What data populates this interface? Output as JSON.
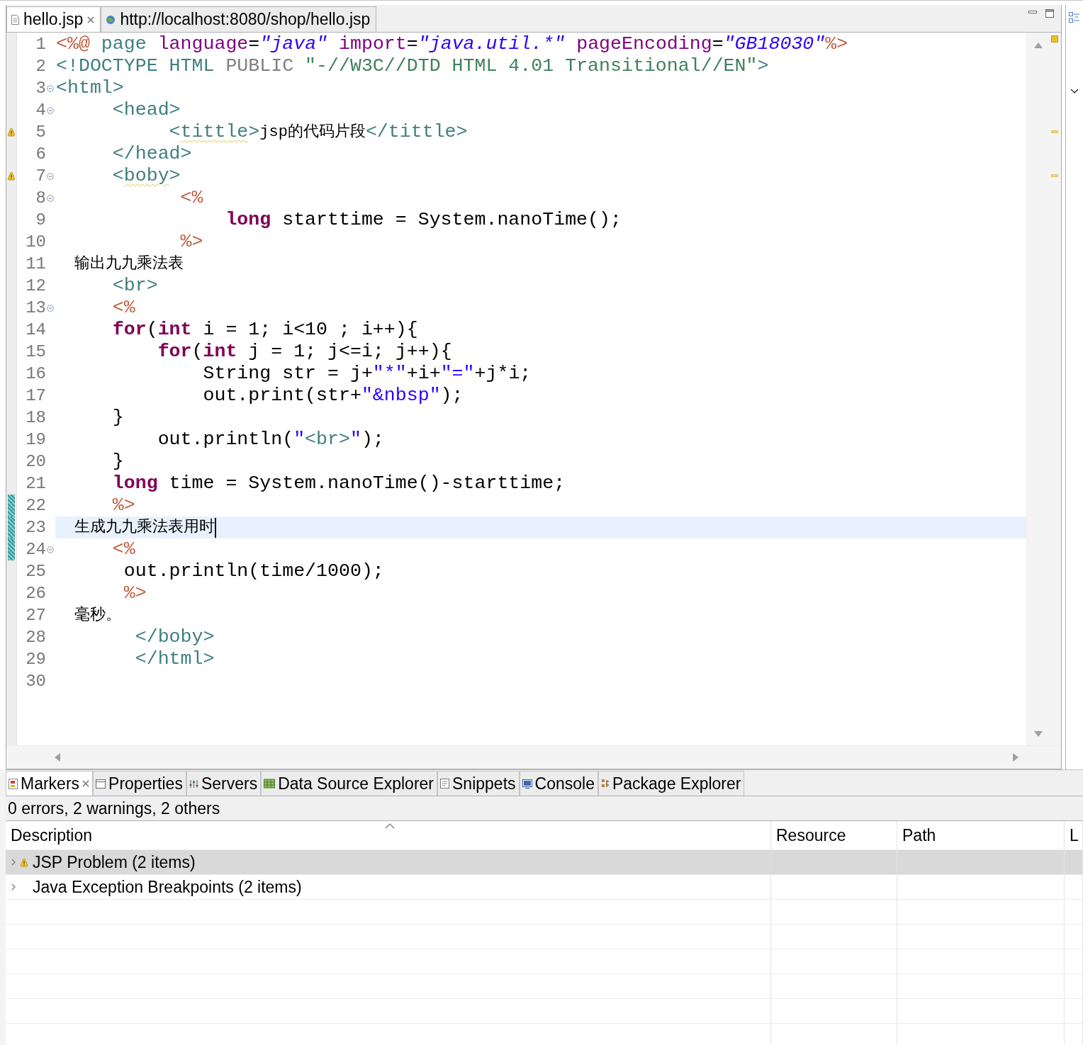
{
  "editor_tabs": [
    {
      "label": "hello.jsp",
      "selected": true,
      "closable": true
    },
    {
      "label": "http://localhost:8080/shop/hello.jsp",
      "selected": false,
      "closable": false
    }
  ],
  "code_lines": [
    {
      "number": "1",
      "foldable": false,
      "warning": false,
      "changed": false,
      "current": false,
      "tokens": [
        {
          "kind": "jsp",
          "text": "<%@"
        },
        {
          "kind": "directive",
          "text": " page"
        },
        {
          "kind": "attr",
          "text": " language"
        },
        {
          "kind": "plain",
          "text": "="
        },
        {
          "kind": "value",
          "text": "\"java\""
        },
        {
          "kind": "attr",
          "text": " import"
        },
        {
          "kind": "plain",
          "text": "="
        },
        {
          "kind": "value",
          "text": "\"java.util.*\""
        },
        {
          "kind": "attr",
          "text": " pageEncoding"
        },
        {
          "kind": "plain",
          "text": "="
        },
        {
          "kind": "value",
          "text": "\"GB18030\""
        },
        {
          "kind": "jsp",
          "text": "%>"
        }
      ]
    },
    {
      "number": "2",
      "foldable": false,
      "warning": false,
      "changed": false,
      "current": false,
      "tokens": [
        {
          "kind": "tag",
          "text": "<!DOCTYPE HTML"
        },
        {
          "kind": "doctype",
          "text": " PUBLIC"
        },
        {
          "kind": "doctype_string",
          "text": " \"-//W3C//DTD HTML 4.01 Transitional//EN\""
        },
        {
          "kind": "tag",
          "text": ">"
        }
      ]
    },
    {
      "number": "3",
      "foldable": true,
      "warning": false,
      "changed": false,
      "current": false,
      "tokens": [
        {
          "kind": "tag",
          "text": "<html>"
        }
      ]
    },
    {
      "number": "4",
      "foldable": true,
      "warning": false,
      "changed": false,
      "current": false,
      "tokens": [
        {
          "kind": "tag",
          "text": "     <head>"
        }
      ]
    },
    {
      "number": "5",
      "foldable": false,
      "warning": true,
      "changed": false,
      "current": false,
      "tokens": [
        {
          "kind": "tag",
          "text": "          <"
        },
        {
          "kind": "tag_warn",
          "text": "tittle"
        },
        {
          "kind": "tag",
          "text": ">"
        },
        {
          "kind": "text",
          "text": "jsp的代码片段"
        },
        {
          "kind": "tag",
          "text": "</tittle>"
        }
      ]
    },
    {
      "number": "6",
      "foldable": false,
      "warning": false,
      "changed": false,
      "current": false,
      "tokens": [
        {
          "kind": "tag",
          "text": "     </head>"
        }
      ]
    },
    {
      "number": "7",
      "foldable": true,
      "warning": true,
      "changed": false,
      "current": false,
      "tokens": [
        {
          "kind": "tag",
          "text": "     <"
        },
        {
          "kind": "tag_warn",
          "text": "boby"
        },
        {
          "kind": "tag",
          "text": ">"
        }
      ]
    },
    {
      "number": "8",
      "foldable": true,
      "warning": false,
      "changed": false,
      "current": false,
      "tokens": [
        {
          "kind": "jsp",
          "text": "           <%"
        }
      ]
    },
    {
      "number": "9",
      "foldable": false,
      "warning": false,
      "changed": false,
      "current": false,
      "tokens": [
        {
          "kind": "keyword",
          "text": "               long"
        },
        {
          "kind": "plain",
          "text": " starttime = System.nanoTime();"
        }
      ]
    },
    {
      "number": "10",
      "foldable": false,
      "warning": false,
      "changed": false,
      "current": false,
      "tokens": [
        {
          "kind": "jsp",
          "text": "           %>"
        }
      ]
    },
    {
      "number": "11",
      "foldable": false,
      "warning": false,
      "changed": false,
      "current": false,
      "tokens": [
        {
          "kind": "text",
          "text": "  输出九九乘法表"
        }
      ]
    },
    {
      "number": "12",
      "foldable": false,
      "warning": false,
      "changed": false,
      "current": false,
      "tokens": [
        {
          "kind": "tag",
          "text": "     <br>"
        }
      ]
    },
    {
      "number": "13",
      "foldable": true,
      "warning": false,
      "changed": false,
      "current": false,
      "tokens": [
        {
          "kind": "jsp",
          "text": "     <%"
        }
      ]
    },
    {
      "number": "14",
      "foldable": false,
      "warning": false,
      "changed": false,
      "current": false,
      "tokens": [
        {
          "kind": "keyword",
          "text": "     for"
        },
        {
          "kind": "plain",
          "text": "("
        },
        {
          "kind": "keyword",
          "text": "int"
        },
        {
          "kind": "plain",
          "text": " i = 1; i<10 ; i++){"
        }
      ]
    },
    {
      "number": "15",
      "foldable": false,
      "warning": false,
      "changed": false,
      "current": false,
      "tokens": [
        {
          "kind": "keyword",
          "text": "         for"
        },
        {
          "kind": "plain",
          "text": "("
        },
        {
          "kind": "keyword",
          "text": "int"
        },
        {
          "kind": "plain",
          "text": " j = 1; j<=i; j++){"
        }
      ]
    },
    {
      "number": "16",
      "foldable": false,
      "warning": false,
      "changed": false,
      "current": false,
      "tokens": [
        {
          "kind": "plain",
          "text": "             String str = j+"
        },
        {
          "kind": "string",
          "text": "\"*\""
        },
        {
          "kind": "plain",
          "text": "+i+"
        },
        {
          "kind": "string",
          "text": "\"=\""
        },
        {
          "kind": "plain",
          "text": "+j*i;"
        }
      ]
    },
    {
      "number": "17",
      "foldable": false,
      "warning": false,
      "changed": false,
      "current": false,
      "tokens": [
        {
          "kind": "plain",
          "text": "             out.print(str+"
        },
        {
          "kind": "string",
          "text": "\"&nbsp\""
        },
        {
          "kind": "plain",
          "text": ");"
        }
      ]
    },
    {
      "number": "18",
      "foldable": false,
      "warning": false,
      "changed": false,
      "current": false,
      "tokens": [
        {
          "kind": "plain",
          "text": "     }"
        }
      ]
    },
    {
      "number": "19",
      "foldable": false,
      "warning": false,
      "changed": false,
      "current": false,
      "tokens": [
        {
          "kind": "plain",
          "text": "         out.println("
        },
        {
          "kind": "string",
          "text": "\""
        },
        {
          "kind": "tag",
          "text": "<br>"
        },
        {
          "kind": "string",
          "text": "\""
        },
        {
          "kind": "plain",
          "text": ");"
        }
      ]
    },
    {
      "number": "20",
      "foldable": false,
      "warning": false,
      "changed": false,
      "current": false,
      "tokens": [
        {
          "kind": "plain",
          "text": "     }"
        }
      ]
    },
    {
      "number": "21",
      "foldable": false,
      "warning": false,
      "changed": false,
      "current": false,
      "tokens": [
        {
          "kind": "keyword",
          "text": "     long"
        },
        {
          "kind": "plain",
          "text": " time = System.nanoTime()-starttime;"
        }
      ]
    },
    {
      "number": "22",
      "foldable": false,
      "warning": false,
      "changed": true,
      "current": false,
      "tokens": [
        {
          "kind": "jsp",
          "text": "     %>"
        }
      ]
    },
    {
      "number": "23",
      "foldable": false,
      "warning": false,
      "changed": true,
      "current": true,
      "tokens": [
        {
          "kind": "text",
          "text": "  生成九九乘法表用时"
        }
      ]
    },
    {
      "number": "24",
      "foldable": true,
      "warning": false,
      "changed": true,
      "current": false,
      "tokens": [
        {
          "kind": "jsp",
          "text": "     <%"
        }
      ]
    },
    {
      "number": "25",
      "foldable": false,
      "warning": false,
      "changed": false,
      "current": false,
      "tokens": [
        {
          "kind": "plain",
          "text": "      out.println(time/1000);"
        }
      ]
    },
    {
      "number": "26",
      "foldable": false,
      "warning": false,
      "changed": false,
      "current": false,
      "tokens": [
        {
          "kind": "jsp",
          "text": "      %>"
        }
      ]
    },
    {
      "number": "27",
      "foldable": false,
      "warning": false,
      "changed": false,
      "current": false,
      "tokens": [
        {
          "kind": "text",
          "text": "  毫秒。"
        }
      ]
    },
    {
      "number": "28",
      "foldable": false,
      "warning": false,
      "changed": false,
      "current": false,
      "tokens": [
        {
          "kind": "tag",
          "text": "       </boby>"
        }
      ]
    },
    {
      "number": "29",
      "foldable": false,
      "warning": false,
      "changed": false,
      "current": false,
      "tokens": [
        {
          "kind": "tag",
          "text": "       </html>"
        }
      ]
    },
    {
      "number": "30",
      "foldable": false,
      "warning": false,
      "changed": false,
      "current": false
    }
  ],
  "panel_tabs": [
    {
      "label": "Markers",
      "selected": true,
      "closable": true
    },
    {
      "label": "Properties",
      "selected": false,
      "closable": false
    },
    {
      "label": "Servers",
      "selected": false,
      "closable": false
    },
    {
      "label": "Data Source Explorer",
      "selected": false,
      "closable": false
    },
    {
      "label": "Snippets",
      "selected": false,
      "closable": false
    },
    {
      "label": "Console",
      "selected": false,
      "closable": false
    },
    {
      "label": "Package Explorer",
      "selected": false,
      "closable": false
    }
  ],
  "markers_summary": "0 errors, 2 warnings, 2 others",
  "markers_table": {
    "columns": [
      "Description",
      "Resource",
      "Path",
      "L"
    ],
    "rows": [
      {
        "description": "JSP Problem (2 items)",
        "warning": true,
        "selected": true
      },
      {
        "description": "Java Exception Breakpoints (2 items)",
        "warning": false,
        "selected": false
      }
    ]
  }
}
